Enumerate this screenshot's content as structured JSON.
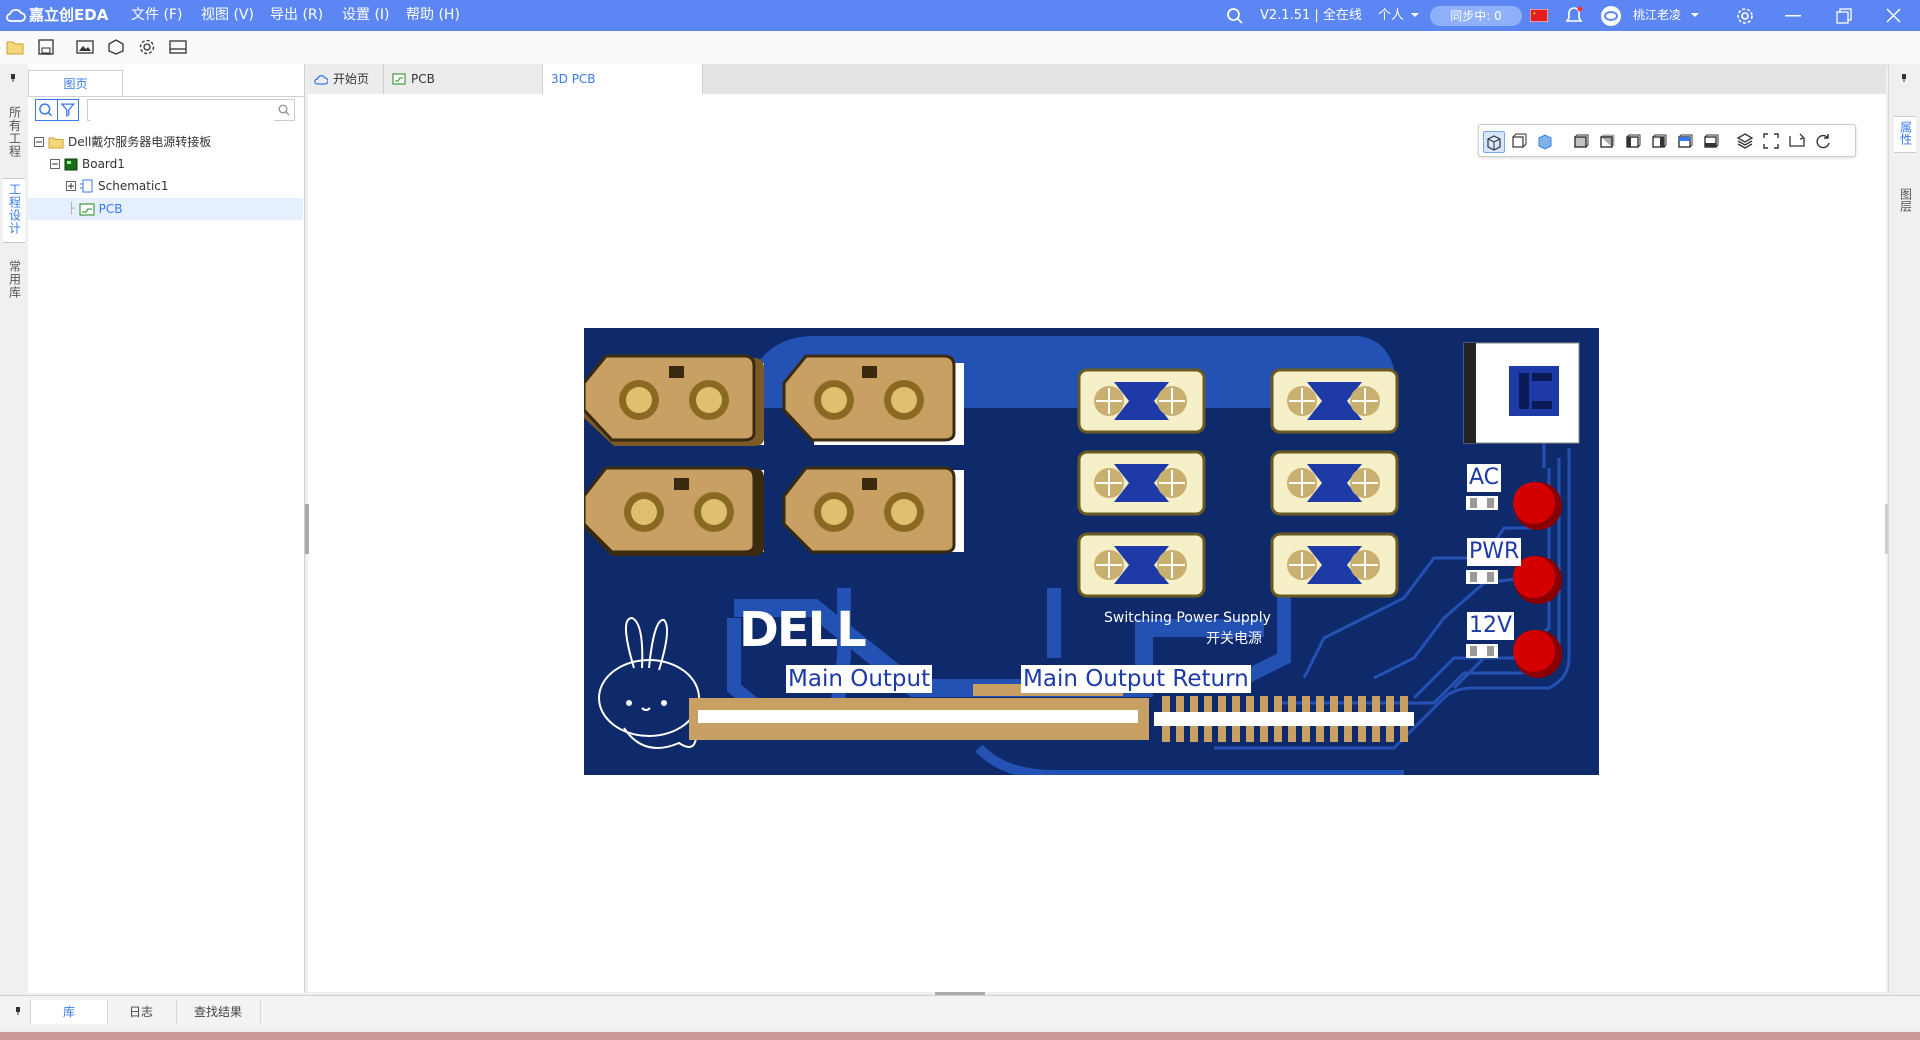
{
  "app": {
    "logo_text": "嘉立创EDA",
    "menus": [
      "文件 (F)",
      "视图 (V)",
      "导出 (R)",
      "设置 (I)",
      "帮助 (H)"
    ],
    "version": "V2.1.51 | 全在线",
    "mode": "个人",
    "sync_status": "同步中: 0",
    "user": "桃江老凌"
  },
  "left_panel": {
    "tab": "图页",
    "vertical_tabs": [
      "所有工程",
      "工程设计",
      "常用库"
    ],
    "search_placeholder": "",
    "tree": [
      {
        "label": "Dell戴尔服务器电源转接板",
        "level": 0
      },
      {
        "label": "Board1",
        "level": 1
      },
      {
        "label": "Schematic1",
        "level": 2
      },
      {
        "label": "PCB",
        "level": 2,
        "selected": true
      }
    ]
  },
  "doc_tabs": [
    {
      "label": "开始页"
    },
    {
      "label": "PCB"
    },
    {
      "label": "3D PCB",
      "active": true
    }
  ],
  "right_tabs": [
    "属性",
    "图层"
  ],
  "bottom_tabs": [
    "库",
    "日志",
    "查找结果"
  ],
  "pcb": {
    "brand": "DELL",
    "silkscreen_1": "Switching Power Supply",
    "silkscreen_2": "开关电源",
    "label_main_output": "Main Output",
    "label_main_output_return": "Main Output Return",
    "led_labels": [
      "AC",
      "PWR",
      "12V"
    ]
  },
  "colors": {
    "titlebar": "#5b86f3",
    "pcb_board": "#0f2a6b",
    "pcb_trace": "#2451b4",
    "connector_gold": "#c8a063",
    "led_red": "#d40000"
  }
}
